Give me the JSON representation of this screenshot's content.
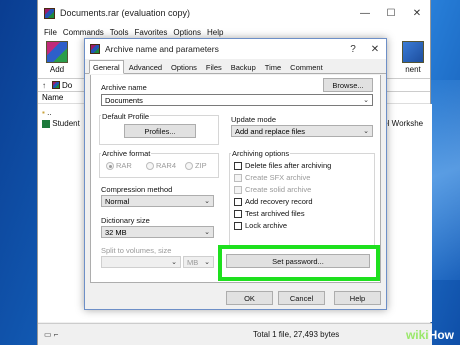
{
  "main_window": {
    "title": "Documents.rar (evaluation copy)",
    "menu": [
      "File",
      "Commands",
      "Tools",
      "Favorites",
      "Options",
      "Help"
    ],
    "toolbar": {
      "add_label": "Add",
      "right_label": "nent"
    },
    "address_text": "Do",
    "list_header": "Name",
    "up_item": "..",
    "file_name": "Student",
    "right_file_text": "tel Workshe",
    "status_text": "Total 1 file, 27,493 bytes"
  },
  "dialog": {
    "title": "Archive name and parameters",
    "help_label": "?",
    "close_label": "✕",
    "tabs": [
      "General",
      "Advanced",
      "Options",
      "Files",
      "Backup",
      "Time",
      "Comment"
    ],
    "archive_name_label": "Archive name",
    "browse_label": "Browse...",
    "archive_name_value": "Documents",
    "default_profile_label": "Default Profile",
    "profiles_label": "Profiles...",
    "update_mode_label": "Update mode",
    "update_mode_value": "Add and replace files",
    "archive_format_label": "Archive format",
    "formats": [
      "RAR",
      "RAR4",
      "ZIP"
    ],
    "archiving_options_label": "Archiving options",
    "options": [
      {
        "label": "Delete files after archiving",
        "checked": false,
        "enabled": true
      },
      {
        "label": "Create SFX archive",
        "checked": false,
        "enabled": false
      },
      {
        "label": "Create solid archive",
        "checked": false,
        "enabled": false
      },
      {
        "label": "Add recovery record",
        "checked": false,
        "enabled": true
      },
      {
        "label": "Test archived files",
        "checked": false,
        "enabled": true
      },
      {
        "label": "Lock archive",
        "checked": false,
        "enabled": true
      }
    ],
    "compression_label": "Compression method",
    "compression_value": "Normal",
    "dictionary_label": "Dictionary size",
    "dictionary_value": "32 MB",
    "split_label": "Split to volumes, size",
    "split_unit": "MB",
    "set_password_label": "Set password...",
    "ok_label": "OK",
    "cancel_label": "Cancel",
    "help_button_label": "Help"
  },
  "watermark": {
    "wiki": "wiki",
    "how": "How"
  },
  "colors": {
    "highlight": "#1ee01e",
    "desktop": "#1565c0"
  },
  "icons": [
    "winrar-icon",
    "minimize-icon",
    "maximize-icon",
    "close-icon",
    "chevron-down-icon",
    "up-folder-icon",
    "excel-file-icon"
  ]
}
